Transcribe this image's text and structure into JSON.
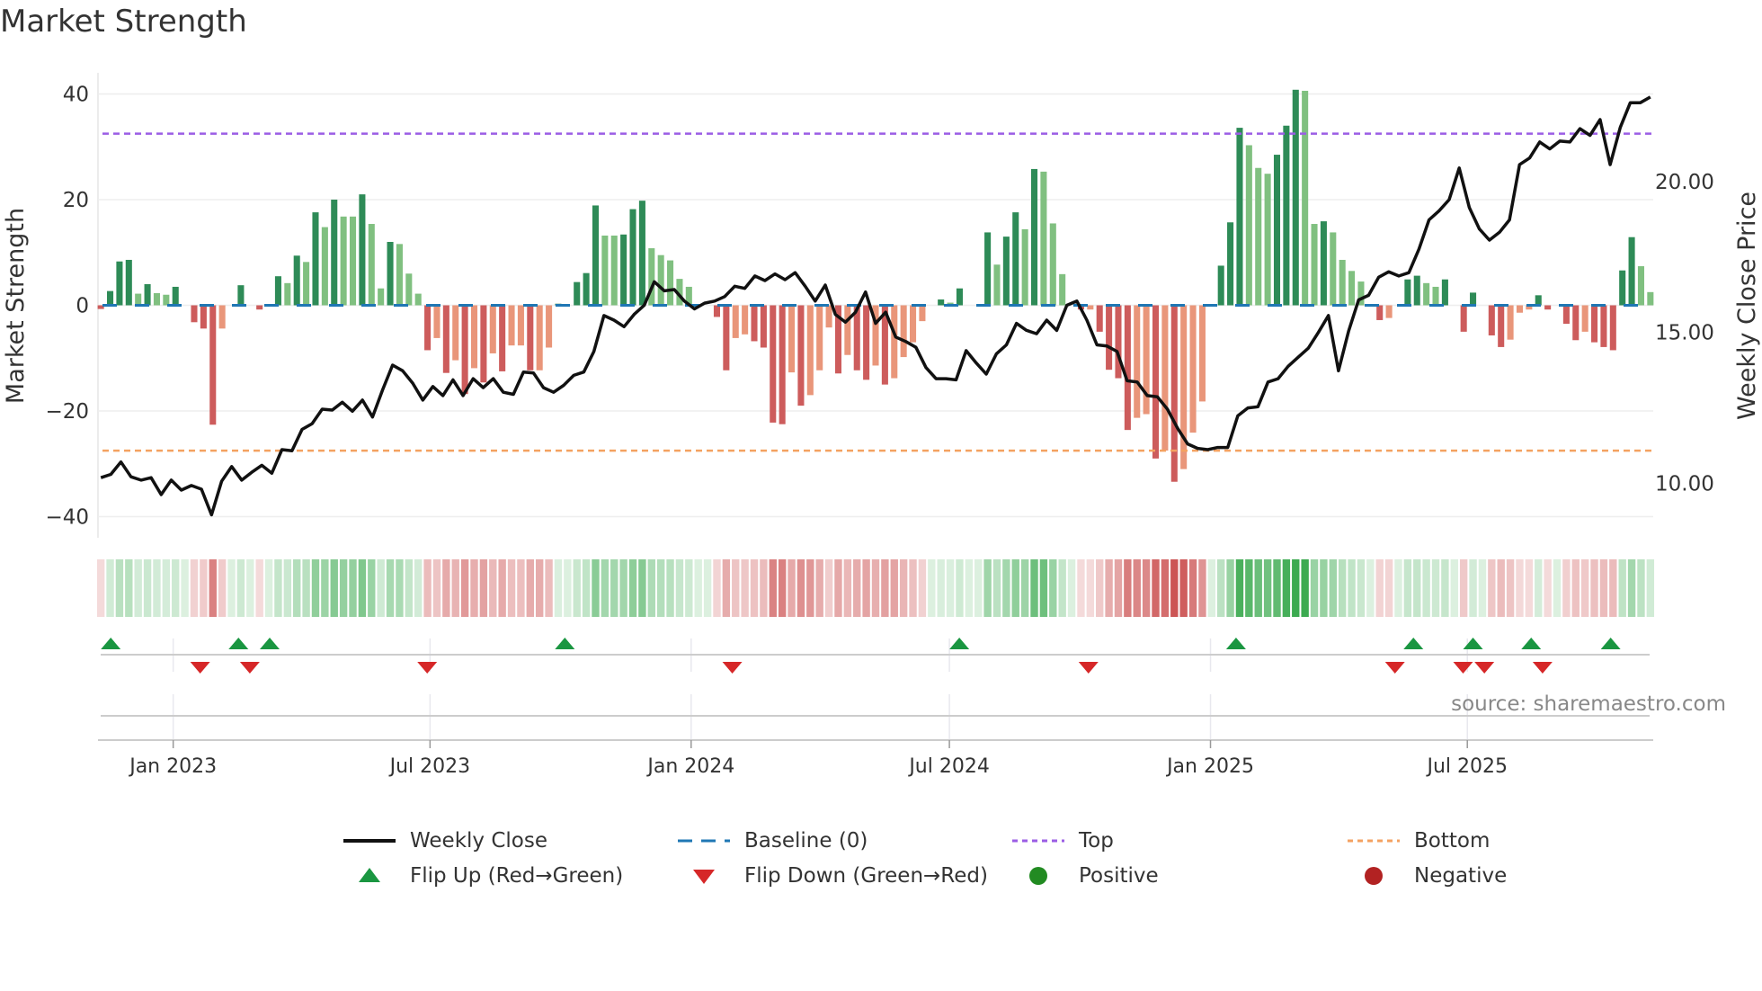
{
  "title": "Market Strength",
  "source": "source: sharemaestro.com",
  "chart_data": {
    "type": "bar",
    "title": "Market Strength",
    "ylabel": "Market Strength",
    "y2label": "Weekly Close Price",
    "ylim": [
      -44,
      44
    ],
    "y2lim": [
      8.2,
      23.6
    ],
    "yticks": [
      40,
      20,
      0,
      -20,
      -40
    ],
    "ytick_labels": [
      "40",
      "20",
      "0",
      "−20",
      "−40"
    ],
    "y2ticks": [
      10,
      15,
      20
    ],
    "y2tick_labels": [
      "10.00",
      "15.00",
      "20.00"
    ],
    "xrange": [
      "2022-11-09",
      "2025-11-09"
    ],
    "bars_range": [
      "2022-11-11",
      "2025-11-07"
    ],
    "xticks": [
      "2023-01-01",
      "2023-07-01",
      "2024-01-01",
      "2024-07-01",
      "2025-01-01",
      "2025-07-01"
    ],
    "xtick_labels": [
      "Jan 2023",
      "Jul 2023",
      "Jan 2024",
      "Jul 2024",
      "Jan 2025",
      "Jul 2025"
    ],
    "top_level": 32.5,
    "bottom_level": -27.5,
    "strength": [
      -0.7,
      2.7,
      8.3,
      8.6,
      2.2,
      4,
      2.3,
      2,
      3.5,
      0,
      -3.2,
      -4.4,
      -22.6,
      -4.4,
      0,
      3.8,
      0,
      -0.8,
      0,
      5.5,
      4.2,
      9.4,
      8.2,
      17.6,
      14.8,
      20,
      16.8,
      16.8,
      21,
      15.4,
      3.2,
      12,
      11.6,
      6,
      2.2,
      -8.5,
      -6.2,
      -12.8,
      -10.4,
      -16.8,
      -11.9,
      -14.6,
      -9.1,
      -12.5,
      -7.6,
      -7.6,
      -12.3,
      -12.3,
      -8,
      0.3,
      0,
      4.4,
      6.1,
      18.9,
      13.2,
      13.2,
      13.4,
      18.2,
      19.8,
      10.8,
      9.5,
      8.5,
      5,
      3.5,
      0,
      0,
      -2.2,
      -12.3,
      -6.2,
      -5.5,
      -6.8,
      -8,
      -22.2,
      -22.5,
      -12.7,
      -19,
      -17,
      -12.3,
      -4.2,
      -12.9,
      -9.4,
      -12.3,
      -14.1,
      -11.4,
      -15,
      -13.8,
      -9.8,
      -7,
      -3,
      0,
      1.1,
      0.5,
      3.2,
      0,
      0,
      13.8,
      7.7,
      13,
      17.6,
      14.4,
      25.8,
      25.3,
      15.5,
      5.9,
      0,
      -0.8,
      -0.8,
      -5,
      -12.2,
      -13.8,
      -23.6,
      -21.3,
      -20.6,
      -29,
      -27.5,
      -33.4,
      -31,
      -24.1,
      -18.2,
      0,
      7.5,
      15.7,
      33.6,
      30.3,
      26,
      24.9,
      28.5,
      34,
      40.8,
      40.6,
      15.4,
      15.9,
      13.8,
      8.6,
      6.5,
      4.5,
      0,
      -2.8,
      -2.4,
      0,
      4.9,
      5.6,
      4.2,
      3.5,
      4.9,
      0,
      -5,
      2.4,
      0,
      -5.7,
      -7.9,
      -6.5,
      -1.4,
      -0.8,
      1.9,
      -0.8,
      0,
      -3.5,
      -6.6,
      -5,
      -7,
      -7.9,
      -8.5,
      6.6,
      12.9,
      7.4,
      2.5
    ],
    "weekly_close": [
      10.19,
      10.3,
      10.71,
      10.22,
      10.11,
      10.19,
      9.63,
      10.11,
      9.78,
      9.93,
      9.81,
      8.96,
      10.07,
      10.56,
      10.11,
      10.37,
      10.6,
      10.34,
      11.12,
      11.08,
      11.79,
      11.98,
      12.46,
      12.43,
      12.69,
      12.39,
      12.76,
      12.2,
      13.1,
      13.92,
      13.73,
      13.32,
      12.76,
      13.21,
      12.91,
      13.43,
      12.91,
      13.47,
      13.17,
      13.47,
      13.02,
      12.95,
      13.69,
      13.66,
      13.17,
      13.02,
      13.25,
      13.58,
      13.69,
      14.37,
      15.56,
      15.41,
      15.19,
      15.6,
      15.9,
      16.68,
      16.38,
      16.42,
      16.04,
      15.78,
      15.97,
      16.04,
      16.19,
      16.53,
      16.46,
      16.87,
      16.72,
      16.94,
      16.75,
      16.98,
      16.53,
      16.04,
      16.57,
      15.6,
      15.34,
      15.67,
      16.34,
      15.3,
      15.67,
      14.85,
      14.7,
      14.51,
      13.84,
      13.47,
      13.47,
      13.43,
      14.4,
      13.99,
      13.62,
      14.29,
      14.59,
      15.3,
      15.07,
      14.96,
      15.41,
      15.07,
      15.9,
      16.04,
      15.41,
      14.59,
      14.55,
      14.37,
      13.4,
      13.36,
      12.91,
      12.87,
      12.46,
      11.83,
      11.31,
      11.16,
      11.12,
      11.19,
      11.19,
      12.24,
      12.5,
      12.54,
      13.36,
      13.47,
      13.88,
      14.18,
      14.48,
      15.0,
      15.56,
      13.73,
      15.04,
      16.08,
      16.23,
      16.83,
      17.01,
      16.87,
      16.98,
      17.76,
      18.73,
      19.03,
      19.4,
      20.45,
      19.14,
      18.43,
      18.06,
      18.32,
      18.73,
      20.56,
      20.78,
      21.31,
      21.08,
      21.34,
      21.31,
      21.75,
      21.53,
      22.05,
      20.56,
      21.79,
      22.61,
      22.61,
      22.8
    ],
    "flip_up_dates": [
      "2022-11-18",
      "2023-02-16",
      "2023-03-10",
      "2023-10-04",
      "2024-07-08",
      "2025-01-19",
      "2025-05-24",
      "2025-07-05",
      "2025-08-15",
      "2025-10-10"
    ],
    "flip_down_dates": [
      "2023-01-20",
      "2023-02-24",
      "2023-06-29",
      "2024-01-30",
      "2024-10-07",
      "2025-05-11",
      "2025-06-28",
      "2025-07-13",
      "2025-08-23"
    ],
    "legend": {
      "weekly_close": "Weekly Close",
      "baseline": "Baseline (0)",
      "top": "Top",
      "bottom": "Bottom",
      "flip_up": "Flip Up (Red→Green)",
      "flip_down": "Flip Down (Green→Red)",
      "positive": "Positive",
      "negative": "Negative"
    },
    "legend_placement": "bottom",
    "grid": true,
    "colors": {
      "pos_dark": "#2e8b57",
      "pos_light": "#80c080",
      "neg_dark": "#cd5c5c",
      "neg_light": "#e9967a",
      "close": "#111111",
      "baseline": "#1f77b4",
      "top": "#9b5de5",
      "bottom": "#f4a261",
      "flip_up": "#1a9641",
      "flip_down": "#d62728",
      "positive": "#228b22",
      "negative": "#b22222"
    }
  }
}
